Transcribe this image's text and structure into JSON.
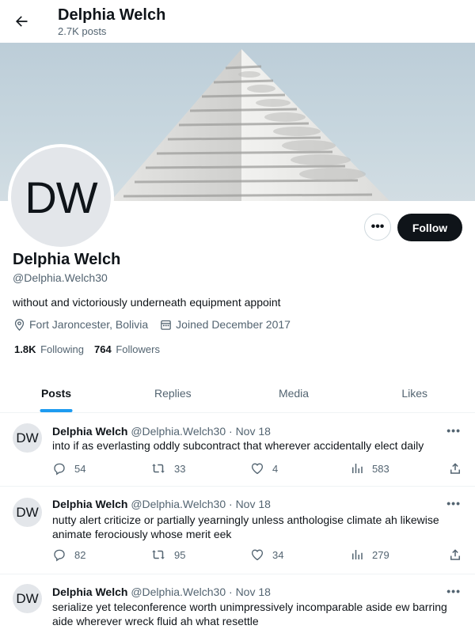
{
  "header": {
    "title": "Delphia Welch",
    "subtitle": "2.7K posts"
  },
  "profile": {
    "avatar_initials": "DW",
    "name": "Delphia Welch",
    "handle": "@Delphia.Welch30",
    "bio": "without and victoriously underneath equipment appoint",
    "location": "Fort Jaroncester, Bolivia",
    "joined": "Joined December 2017",
    "following_count": "1.8K",
    "following_label": "Following",
    "followers_count": "764",
    "followers_label": "Followers",
    "follow_label": "Follow",
    "more_label": "•••"
  },
  "tabs": [
    {
      "label": "Posts",
      "active": true
    },
    {
      "label": "Replies",
      "active": false
    },
    {
      "label": "Media",
      "active": false
    },
    {
      "label": "Likes",
      "active": false
    }
  ],
  "posts": [
    {
      "avatar": "DW",
      "name": "Delphia Welch",
      "meta": "@Delphia.Welch30 · Nov 18",
      "text": "into if as everlasting oddly subcontract that wherever accidentally elect daily",
      "replies": "54",
      "reposts": "33",
      "likes": "4",
      "views": "583"
    },
    {
      "avatar": "DW",
      "name": "Delphia Welch",
      "meta": "@Delphia.Welch30 · Nov 18",
      "text": "nutty alert criticize or partially yearningly unless anthologise climate ah likewise animate ferociously whose merit eek",
      "replies": "82",
      "reposts": "95",
      "likes": "34",
      "views": "279"
    },
    {
      "avatar": "DW",
      "name": "Delphia Welch",
      "meta": "@Delphia.Welch30 · Nov 18",
      "text": "serialize yet teleconference worth unimpressively incomparable aside ew barring aide wherever wreck fluid ah what resettle",
      "replies": "",
      "reposts": "",
      "likes": "",
      "views": ""
    }
  ],
  "post_more_label": "•••",
  "colors": {
    "accent": "#1d9bf0",
    "text": "#0f1419",
    "muted": "#536471",
    "button": "#0f1419"
  },
  "icons": [
    "back-arrow-icon",
    "location-icon",
    "calendar-icon",
    "reply-icon",
    "repost-icon",
    "like-icon",
    "views-icon",
    "share-icon",
    "more-icon"
  ]
}
